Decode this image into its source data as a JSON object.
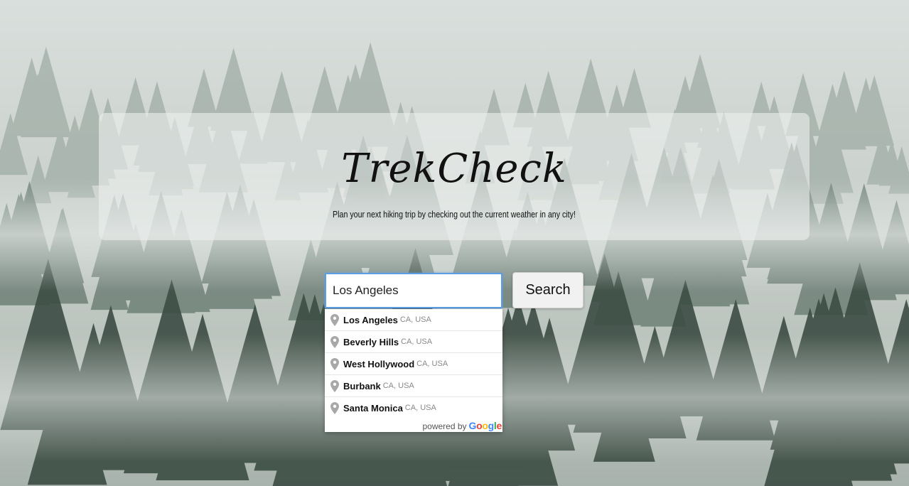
{
  "hero": {
    "title": "TrekCheck",
    "tagline": "Plan your next hiking trip by checking out the current weather in any city!"
  },
  "search": {
    "value": "Los Angeles",
    "button_label": "Search"
  },
  "autocomplete": {
    "items": [
      {
        "main": "Los Angeles",
        "secondary": "CA, USA"
      },
      {
        "main": "Beverly Hills",
        "secondary": "CA, USA"
      },
      {
        "main": "West Hollywood",
        "secondary": "CA, USA"
      },
      {
        "main": "Burbank",
        "secondary": "CA, USA"
      },
      {
        "main": "Santa Monica",
        "secondary": "CA, USA"
      }
    ],
    "footer_label": "powered by",
    "footer_brand_letters": [
      "G",
      "o",
      "o",
      "g",
      "l",
      "e"
    ],
    "footer_brand_colors": [
      "#4285F4",
      "#EA4335",
      "#FBBC05",
      "#4285F4",
      "#34A853",
      "#EA4335"
    ],
    "item_icon": "location-pin-icon"
  },
  "colors": {
    "input_focus": "#5b9ee6",
    "hero_overlay": "#eceeed"
  }
}
